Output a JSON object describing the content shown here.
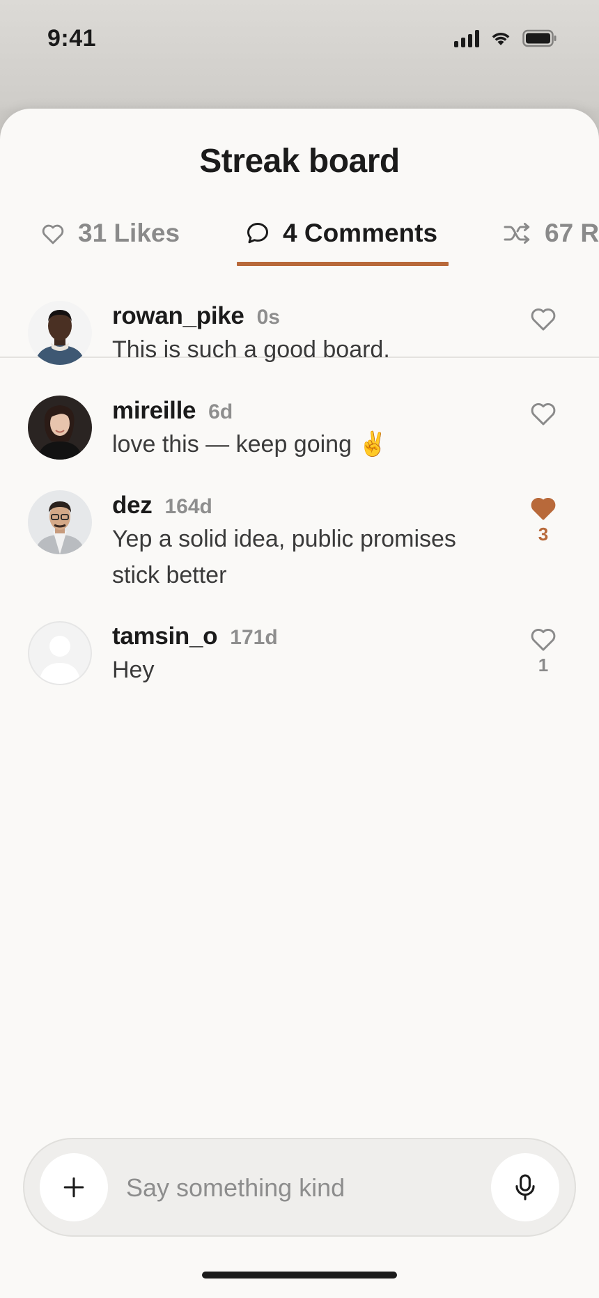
{
  "status_bar": {
    "time": "9:41",
    "icons": [
      "signal-icon",
      "wifi-icon",
      "battery-icon"
    ]
  },
  "sheet": {
    "title": "Streak board"
  },
  "tabs": [
    {
      "icon": "heart-outline-icon",
      "label": "31 Likes",
      "selected": false
    },
    {
      "icon": "comment-bubble-icon",
      "label": "4 Comments",
      "selected": true
    },
    {
      "icon": "shuffle-icon",
      "label": "67 R",
      "selected": false
    }
  ],
  "colors": {
    "accent": "#b8693a",
    "text": "#1b1b1b",
    "muted": "#8e8e8e",
    "sheet_bg": "#faf9f7"
  },
  "comments": [
    {
      "username": "rowan_pike",
      "time": "0s",
      "text": "This is such a good board.",
      "liked": false,
      "like_count": ""
    },
    {
      "username": "mireille",
      "time": "6d",
      "text": "love this — keep going ✌️",
      "liked": false,
      "like_count": ""
    },
    {
      "username": "dez",
      "time": "164d",
      "text": "Yep a solid idea, public promises stick better",
      "liked": true,
      "like_count": "3"
    },
    {
      "username": "tamsin_o",
      "time": "171d",
      "text": "Hey",
      "liked": false,
      "like_count": "1"
    }
  ],
  "composer": {
    "placeholder": "Say something kind",
    "add_icon": "plus-icon",
    "mic_icon": "microphone-icon"
  }
}
